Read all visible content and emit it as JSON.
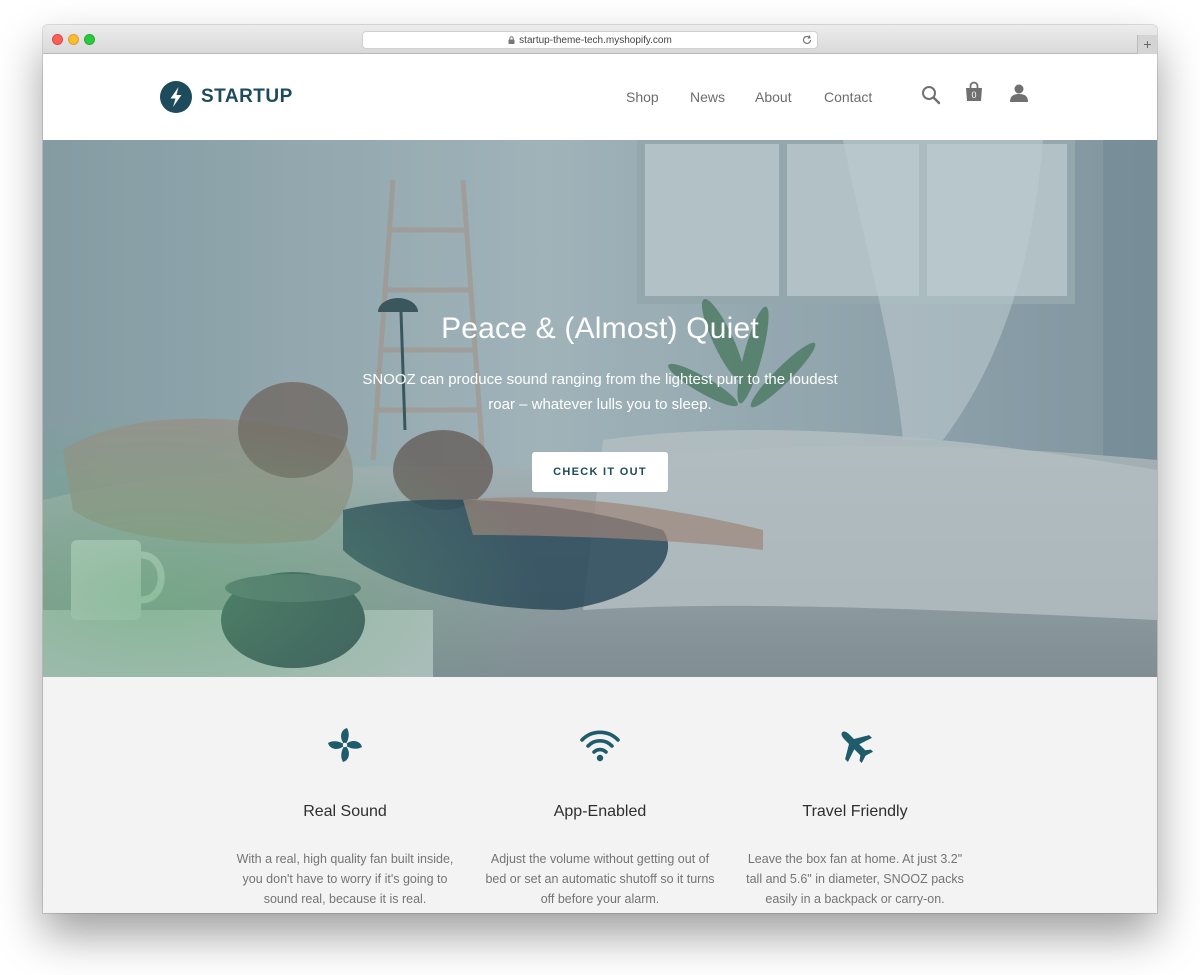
{
  "browser": {
    "url": "startup-theme-tech.myshopify.com",
    "new_tab_label": "+"
  },
  "header": {
    "logo_text": "STARTUP",
    "nav": [
      "Shop",
      "News",
      "About",
      "Contact"
    ],
    "cart_count": "0",
    "icons": [
      "search-icon",
      "cart-icon",
      "account-icon"
    ]
  },
  "hero": {
    "title": "Peace & (Almost) Quiet",
    "subtitle": "SNOOZ can produce sound ranging from the lightest purr to the loudest roar – whatever lulls you to sleep.",
    "cta_label": "CHECK IT OUT"
  },
  "features": [
    {
      "icon": "fan-icon",
      "title": "Real Sound",
      "text": "With a real, high quality fan built inside, you don't have to worry if it's going to sound real, because it is real."
    },
    {
      "icon": "wifi-icon",
      "title": "App-Enabled",
      "text": "Adjust the volume without getting out of bed or set an automatic shutoff so it turns off before your alarm."
    },
    {
      "icon": "airplane-icon",
      "title": "Travel Friendly",
      "text": "Leave the box fan at home. At just 3.2\" tall and 5.6\" in diameter, SNOOZ packs easily in a backpack or carry-on."
    }
  ],
  "colors": {
    "brand": "#1d4b5b",
    "icon_teal": "#1f5c6b",
    "nav_text": "#6d6d6d",
    "feature_bg": "#f3f3f3"
  }
}
